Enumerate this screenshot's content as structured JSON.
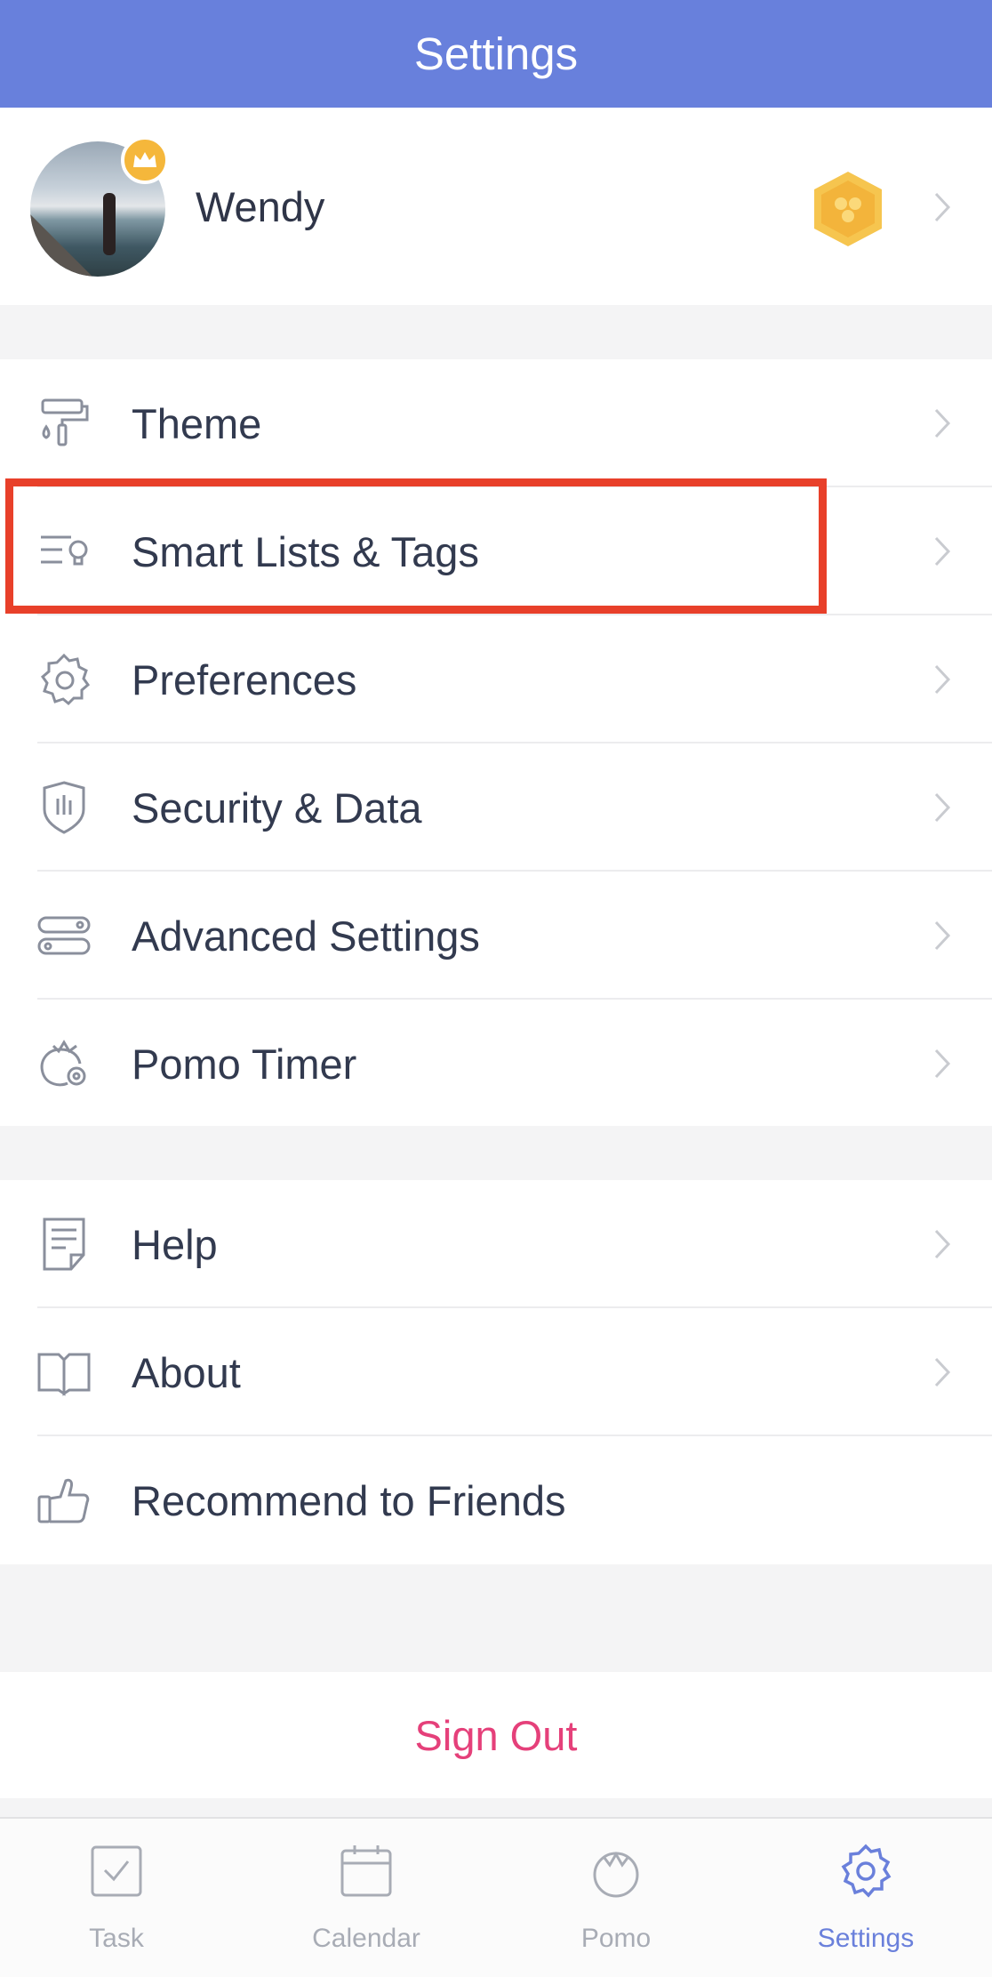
{
  "header": {
    "title": "Settings"
  },
  "profile": {
    "name": "Wendy"
  },
  "section1": [
    {
      "label": "Theme",
      "icon": "paint-roller-icon"
    },
    {
      "label": "Smart Lists & Tags",
      "icon": "list-bulb-icon"
    },
    {
      "label": "Preferences",
      "icon": "gear-icon"
    },
    {
      "label": "Security & Data",
      "icon": "shield-icon"
    },
    {
      "label": "Advanced Settings",
      "icon": "toggles-icon"
    },
    {
      "label": "Pomo Timer",
      "icon": "tomato-gear-icon"
    }
  ],
  "section2": [
    {
      "label": "Help",
      "icon": "document-icon"
    },
    {
      "label": "About",
      "icon": "book-icon"
    },
    {
      "label": "Recommend to Friends",
      "icon": "thumbs-up-icon"
    }
  ],
  "signout": {
    "label": "Sign Out"
  },
  "tabbar": {
    "tabs": [
      {
        "label": "Task",
        "icon": "checkbox-icon"
      },
      {
        "label": "Calendar",
        "icon": "calendar-icon"
      },
      {
        "label": "Pomo",
        "icon": "tomato-icon"
      },
      {
        "label": "Settings",
        "icon": "gear-icon"
      }
    ],
    "active": "Settings"
  },
  "colors": {
    "header": "#6880dc",
    "accent": "#6a80db",
    "signout": "#e5407a",
    "highlight": "#e8402a"
  }
}
